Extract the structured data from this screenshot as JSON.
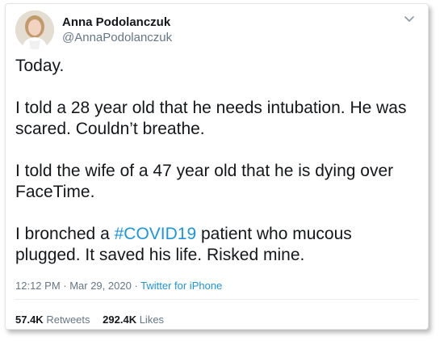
{
  "tweet": {
    "author_name": "Anna Podolanczuk",
    "author_handle": "@AnnaPodolanczuk",
    "paragraphs": {
      "p1": "Today.",
      "p2": "I told a 28 year old that he needs intubation. He was scared. Couldn’t breathe.",
      "p3": "I told the wife of a 47 year old that he is dying over FaceTime.",
      "p4_before": "I bronched a ",
      "p4_hashtag": "#COVID19",
      "p4_after": " patient who mucous plugged. It saved his life. Risked mine."
    },
    "time": "12:12 PM · Mar 29, 2020 · ",
    "source": "Twitter for iPhone",
    "retweets_count": "57.4K",
    "retweets_label": "Retweets",
    "likes_count": "292.4K",
    "likes_label": "Likes"
  },
  "icons": {
    "menu": "chevron-down-icon",
    "avatar": "avatar"
  },
  "colors": {
    "link": "#1b95e0",
    "text": "#14171a",
    "secondary": "#657786"
  }
}
